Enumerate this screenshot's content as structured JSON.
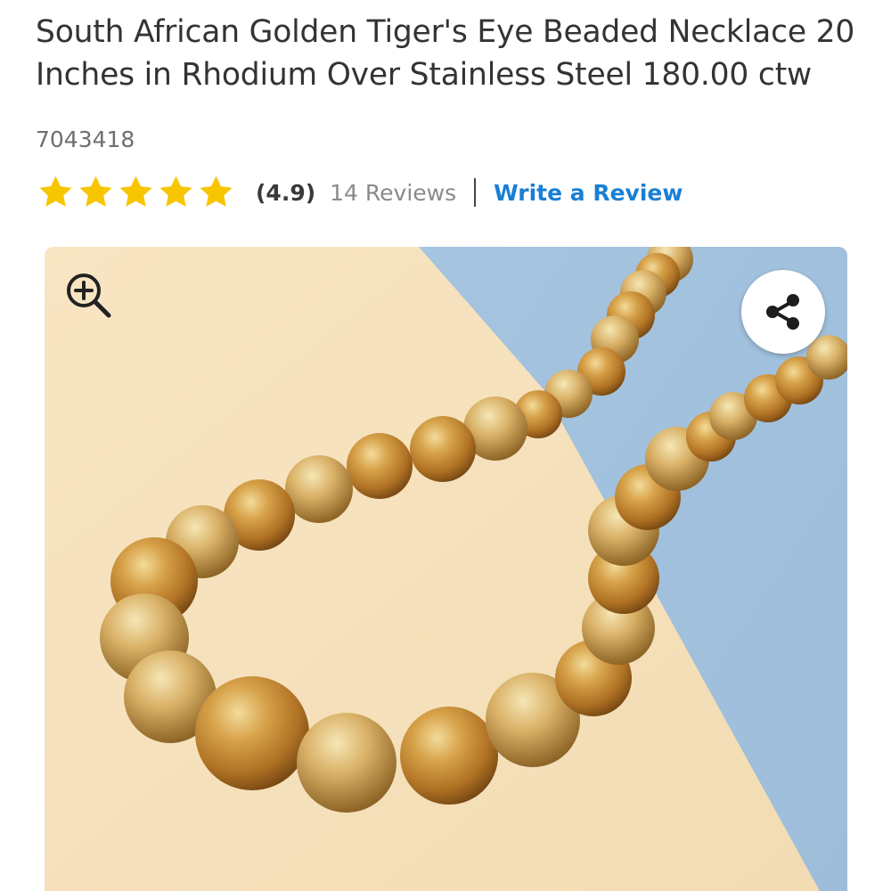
{
  "product": {
    "title": "South African Golden Tiger's Eye Beaded Necklace 20 Inches in Rhodium Over Stainless Steel 180.00 ctw",
    "sku": "7043418"
  },
  "rating": {
    "stars": 5,
    "value_text": "(4.9)",
    "reviews_text": "14 Reviews",
    "write_review_label": "Write a Review"
  },
  "gallery": {
    "zoom_icon": "zoom-in-icon",
    "share_icon": "share-icon"
  },
  "colors": {
    "star": "#f7c600",
    "link": "#1a7fd4",
    "backdrop_cream": "#f7e6c4",
    "backdrop_blue": "#a8c6e0",
    "bead": "#c98a2e"
  }
}
